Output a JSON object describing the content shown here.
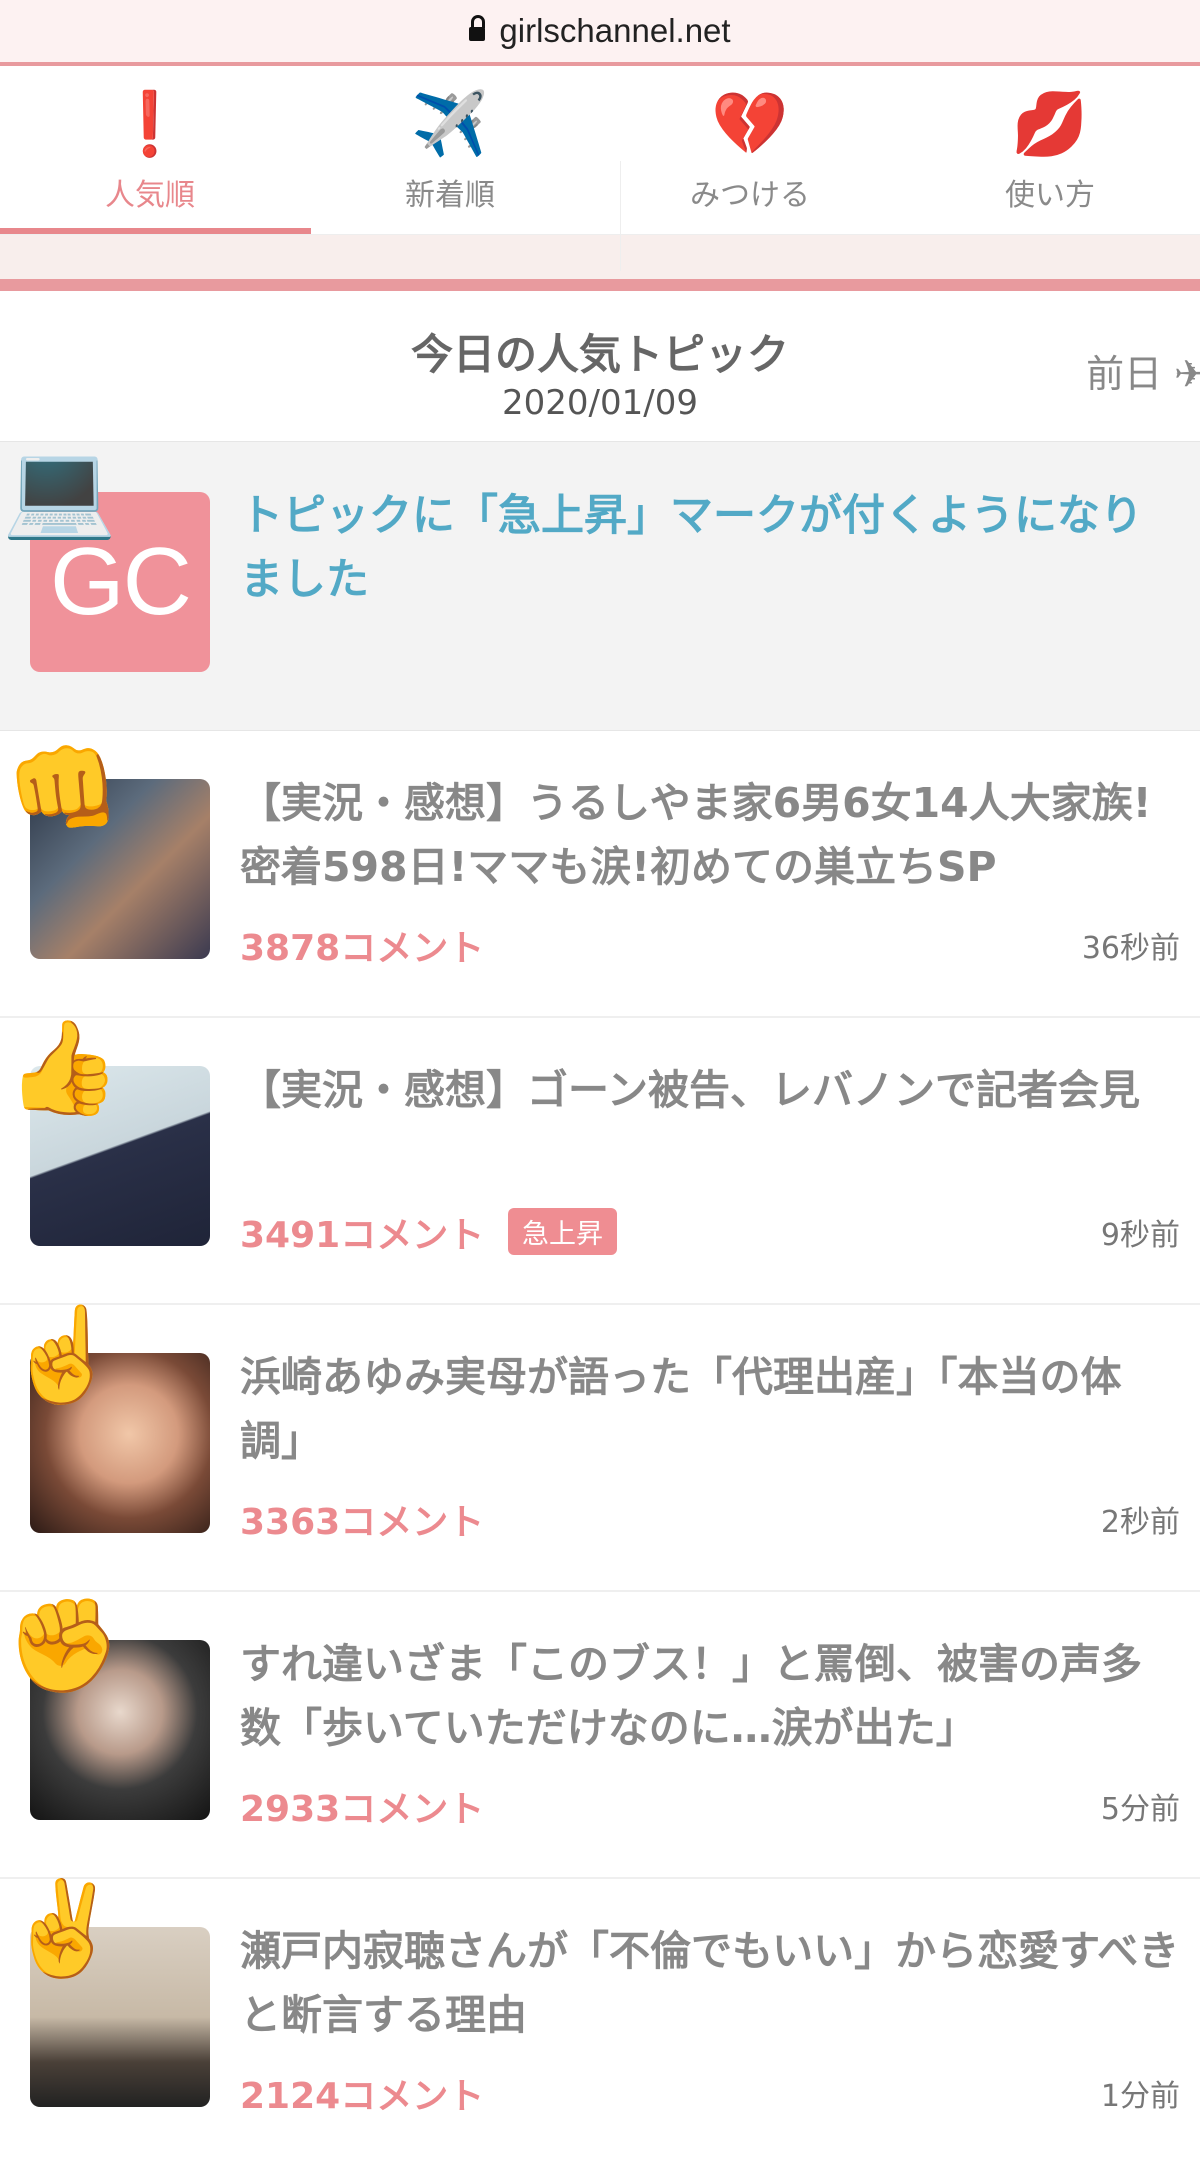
{
  "browser": {
    "url": "girlschannel.net"
  },
  "tabs": [
    {
      "icon": "❗",
      "icon_name": "exclamation-icon",
      "label": "人気順",
      "active": true
    },
    {
      "icon": "✈️",
      "icon_name": "airplane-icon",
      "label": "新着順",
      "active": false
    },
    {
      "icon": "💔",
      "icon_name": "broken-heart-icon",
      "label": "みつける",
      "active": false
    },
    {
      "icon": "💋",
      "icon_name": "kiss-mark-icon",
      "label": "使い方",
      "active": false
    }
  ],
  "section": {
    "title": "今日の人気トピック",
    "date": "2020/01/09",
    "prev_label": "前日 ✈"
  },
  "notice": {
    "icon": "💻",
    "icon_name": "laptop-icon",
    "thumb_text": "GC",
    "title": "トピックに「急上昇」マークが付くようになりました"
  },
  "topics": [
    {
      "rank_icon": "👊",
      "rank_icon_name": "fist-icon",
      "title": "【実況・感想】うるしやま家6男6女14人大家族!密着598日!ママも涙!初めての巣立ちSP",
      "comments": "3878コメント",
      "badge": "",
      "time": "36秒前"
    },
    {
      "rank_icon": "👍",
      "rank_icon_name": "thumbs-up-icon",
      "title": "【実況・感想】ゴーン被告、レバノンで記者会見",
      "comments": "3491コメント",
      "badge": "急上昇",
      "time": "9秒前"
    },
    {
      "rank_icon": "☝️",
      "rank_icon_name": "pointing-up-icon",
      "title": "浜崎あゆみ実母が語った「代理出産」「本当の体調」",
      "comments": "3363コメント",
      "badge": "",
      "time": "2秒前"
    },
    {
      "rank_icon": "✊",
      "rank_icon_name": "raised-fist-icon",
      "title": "すれ違いざま「このブス！」と罵倒、被害の声多数「歩いていただけなのに…涙が出た」",
      "comments": "2933コメント",
      "badge": "",
      "time": "5分前"
    },
    {
      "rank_icon": "✌️",
      "rank_icon_name": "victory-hand-icon",
      "title": "瀬戸内寂聴さんが「不倫でもいい」から恋愛すべきと断言する理由",
      "comments": "2124コメント",
      "badge": "",
      "time": "1分前"
    }
  ],
  "colors": {
    "accent": "#e8878c",
    "link": "#52a9c6",
    "badge": "#ef8d92"
  }
}
